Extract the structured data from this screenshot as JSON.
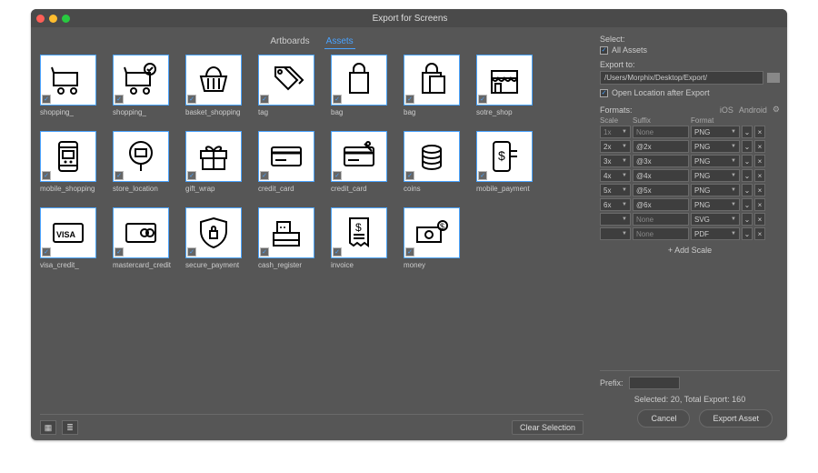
{
  "header": {
    "title": "Export for Screens"
  },
  "tabs": {
    "artboards": "Artboards",
    "assets": "Assets",
    "active": "assets"
  },
  "assets": [
    {
      "label": "shopping_",
      "icon": "cart"
    },
    {
      "label": "shopping_",
      "icon": "cart-check"
    },
    {
      "label": "basket_shopping",
      "icon": "basket"
    },
    {
      "label": "tag",
      "icon": "tag"
    },
    {
      "label": "bag",
      "icon": "bag"
    },
    {
      "label": "bag",
      "icon": "bag-dual"
    },
    {
      "label": "sotre_shop",
      "icon": "store"
    },
    {
      "label": "mobile_shopping",
      "icon": "mobile-cart"
    },
    {
      "label": "store_location",
      "icon": "pin-cart"
    },
    {
      "label": "gift_wrap",
      "icon": "gift"
    },
    {
      "label": "credit_card",
      "icon": "card"
    },
    {
      "label": "credit_card",
      "icon": "card-cut"
    },
    {
      "label": "coins",
      "icon": "coins"
    },
    {
      "label": "mobile_payment",
      "icon": "phone-money"
    },
    {
      "label": "visa_credit_",
      "icon": "visa"
    },
    {
      "label": "mastercard_credit",
      "icon": "mastercard"
    },
    {
      "label": "secure_payment",
      "icon": "shield-lock"
    },
    {
      "label": "cash_register",
      "icon": "register"
    },
    {
      "label": "invoice",
      "icon": "invoice"
    },
    {
      "label": "money",
      "icon": "money"
    }
  ],
  "sidebar": {
    "selectLabel": "Select:",
    "allAssets": "All Assets",
    "exportToLabel": "Export to:",
    "path": "/Users/Morphix/Desktop/Export/",
    "openAfter": "Open Location after Export",
    "formatsLabel": "Formats:",
    "iOS": "iOS",
    "android": "Android",
    "cols": {
      "scale": "Scale",
      "suffix": "Suffix",
      "format": "Format"
    },
    "rows": [
      {
        "scale": "1x",
        "suffix": "None",
        "format": "PNG",
        "dim": true
      },
      {
        "scale": "2x",
        "suffix": "@2x",
        "format": "PNG"
      },
      {
        "scale": "3x",
        "suffix": "@3x",
        "format": "PNG"
      },
      {
        "scale": "4x",
        "suffix": "@4x",
        "format": "PNG"
      },
      {
        "scale": "5x",
        "suffix": "@5x",
        "format": "PNG"
      },
      {
        "scale": "6x",
        "suffix": "@6x",
        "format": "PNG"
      },
      {
        "scale": "",
        "suffix": "None",
        "format": "SVG",
        "dim": true
      },
      {
        "scale": "",
        "suffix": "None",
        "format": "PDF",
        "dim": true
      }
    ],
    "addScale": "+ Add Scale",
    "prefixLabel": "Prefix:"
  },
  "footer": {
    "clear": "Clear Selection",
    "summary": "Selected: 20, Total Export: 160",
    "cancel": "Cancel",
    "export": "Export Asset"
  }
}
